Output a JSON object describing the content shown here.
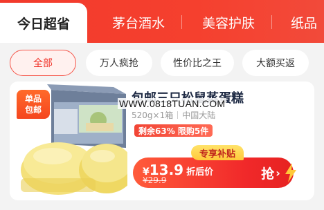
{
  "tabs": {
    "active": "今日超省",
    "items": [
      "茅台酒水",
      "美容护肤",
      "纸品"
    ]
  },
  "chips": [
    "全部",
    "万人疯抢",
    "性价比之王",
    "大额买返"
  ],
  "product": {
    "badge_line1": "单品",
    "badge_line2": "包邮",
    "title": "包邮三只松鼠蒸蛋糕",
    "watermark": "WWW.0818TUAN.COM",
    "spec_weight": "520g×1箱",
    "spec_origin": "中国大陆",
    "stock_tag": "剩余63% 限购5件",
    "subsidy_tag": "专享补贴",
    "currency": "¥",
    "price": "13.9",
    "price_suffix": "折后价",
    "original_price": "¥29.9",
    "buy_label": "抢",
    "buy_arrow": "›"
  },
  "colors": {
    "brand_red": "#f23a2c",
    "accent_yellow": "#ffc93a"
  }
}
